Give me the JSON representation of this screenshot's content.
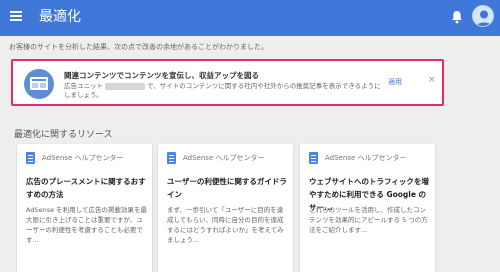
{
  "appbar": {
    "title": "最適化",
    "menu_icon": "menu-icon",
    "bell_icon": "bell-icon",
    "avatar_icon": "avatar-icon",
    "color": "#3f78d8"
  },
  "intro_text": "お客様のサイトを分析した結果、次の点で改善の余地があることがわかりました。",
  "opportunity": {
    "title": "関連コンテンツでコンテンツを宣伝し、収益アップを図る",
    "desc_before": "広告ユニット",
    "desc_after": "で、サイトのコンテンツに関する社内や社外からの推奨記事を表示できるようにしましょう。",
    "apply_label": "適用",
    "close_label": "×",
    "border_color": "#e52a6f"
  },
  "resources": {
    "section_title": "最適化に関するリソース",
    "cards": [
      {
        "source": "AdSense ヘルプセンター",
        "title": "広告のプレースメントに関するおすすめの方法",
        "desc": "AdSense を利用して広告の掲載効果を最大限に引き上げることは重要ですが、ユーザーの利便性を考慮することも必要です..."
      },
      {
        "source": "AdSense ヘルプセンター",
        "title": "ユーザーの利便性に関するガイドライン",
        "desc": "まず、一歩引いて「ユーザーに目的を達成してもらい、同時に自分の目的を達成するにはどうすればよいか」を考えてみましょう..."
      },
      {
        "source": "AdSense ヘルプセンター",
        "title": "ウェブサイトへのトラフィックを増やすために利用できる Google のサー...",
        "desc": "これらのツールを活用し、作成したコンテンツを効果的にアピールする 5 つの方法をご紹介します..."
      }
    ]
  }
}
